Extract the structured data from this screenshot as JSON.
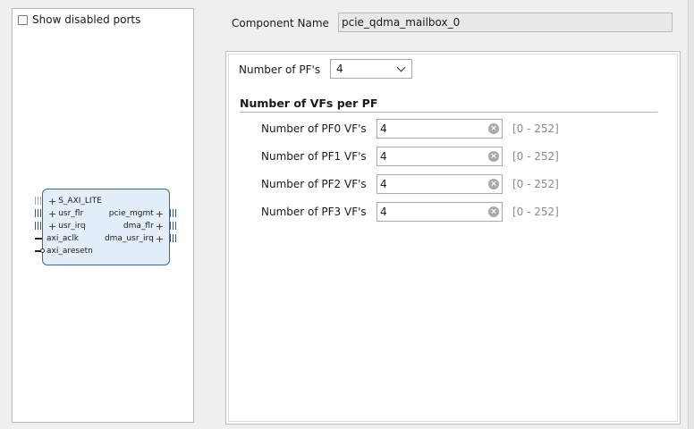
{
  "symbol_panel": {
    "show_disabled_label": "Show disabled ports",
    "show_disabled_checked": false,
    "ip": {
      "left_ports": [
        "S_AXI_LITE",
        "usr_flr",
        "usr_irq",
        "axi_aclk",
        "axi_aresetn"
      ],
      "right_ports": [
        "pcie_mgmt",
        "dma_flr",
        "dma_usr_irq"
      ]
    }
  },
  "component": {
    "label": "Component Name",
    "value": "pcie_qdma_mailbox_0"
  },
  "config": {
    "pf_label": "Number of PF's",
    "pf_value": "4",
    "section_title": "Number of VFs per PF",
    "vf_rows": [
      {
        "label": "Number of PF0 VF's",
        "value": "4",
        "range": "[0 - 252]"
      },
      {
        "label": "Number of PF1 VF's",
        "value": "4",
        "range": "[0 - 252]"
      },
      {
        "label": "Number of PF2 VF's",
        "value": "4",
        "range": "[0 - 252]"
      },
      {
        "label": "Number of PF3 VF's",
        "value": "4",
        "range": "[0 - 252]"
      }
    ]
  },
  "icons": {
    "clear": "clear-icon",
    "dropdown": "chevron-down-icon",
    "port_expand": "plus-icon"
  },
  "colors": {
    "ip_fill": "#e3eef8",
    "ip_border": "#3a6d94",
    "bus": "#2f5f8c"
  }
}
